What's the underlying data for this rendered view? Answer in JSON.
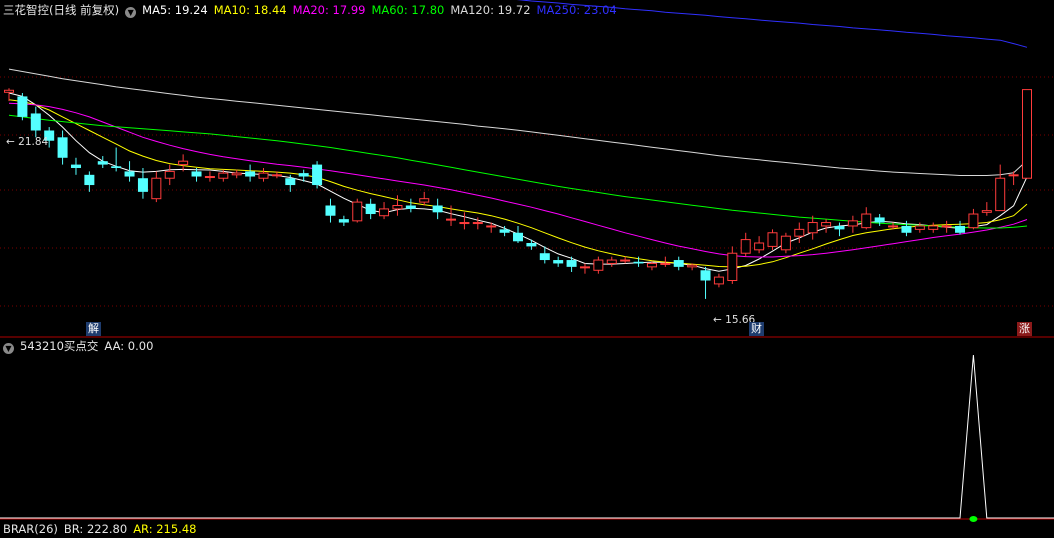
{
  "stock_title": "三花智控(日线 前复权)",
  "ma_legend": [
    {
      "label": "MA5: 19.24",
      "color": "#ffffff"
    },
    {
      "label": "MA10: 18.44",
      "color": "#ffff00"
    },
    {
      "label": "MA20: 17.99",
      "color": "#ff00ff"
    },
    {
      "label": "MA60: 17.80",
      "color": "#00ff00"
    },
    {
      "label": "MA120: 19.72",
      "color": "#d9d9d9"
    },
    {
      "label": "MA250: 23.04",
      "color": "#3030ff"
    }
  ],
  "annotations": {
    "high": "21.84",
    "low": "15.66"
  },
  "event_markers": {
    "jie": "解",
    "cai": "财",
    "zhang": "涨"
  },
  "indicator": {
    "name": "543210买点交",
    "value": "AA: 0.00"
  },
  "bottom_panel": {
    "name": "BRAR(26)",
    "br": "BR: 222.80",
    "ar": "AR: 215.48"
  },
  "colors": {
    "up": "#ff3c3c",
    "down": "#54ffff",
    "separator": "#8b0000",
    "grid": "#7a0000"
  },
  "chart_data": {
    "type": "candlestick",
    "price_ylim": [
      15.1,
      23.9
    ],
    "candles": [
      [
        21.72,
        21.78,
        21.84,
        21.46
      ],
      [
        21.6,
        21.0,
        21.7,
        20.9
      ],
      [
        21.1,
        20.6,
        21.3,
        20.4
      ],
      [
        20.6,
        20.3,
        20.7,
        20.1
      ],
      [
        20.4,
        19.8,
        20.6,
        19.6
      ],
      [
        19.6,
        19.5,
        19.8,
        19.3
      ],
      [
        19.3,
        19.0,
        19.4,
        18.8
      ],
      [
        19.7,
        19.6,
        19.85,
        19.5
      ],
      [
        19.55,
        19.5,
        20.1,
        19.4
      ],
      [
        19.4,
        19.25,
        19.7,
        19.1
      ],
      [
        19.2,
        18.8,
        19.5,
        18.6
      ],
      [
        18.6,
        19.2,
        19.4,
        18.5
      ],
      [
        19.2,
        19.4,
        19.6,
        19.0
      ],
      [
        19.6,
        19.7,
        19.9,
        19.4
      ],
      [
        19.4,
        19.25,
        19.5,
        19.1
      ],
      [
        19.25,
        19.25,
        19.4,
        19.1
      ],
      [
        19.2,
        19.35,
        19.45,
        19.1
      ],
      [
        19.3,
        19.35,
        19.45,
        19.2
      ],
      [
        19.4,
        19.25,
        19.6,
        19.1
      ],
      [
        19.2,
        19.35,
        19.5,
        19.1
      ],
      [
        19.3,
        19.3,
        19.4,
        19.2
      ],
      [
        19.2,
        19.0,
        19.3,
        18.8
      ],
      [
        19.35,
        19.25,
        19.45,
        19.1
      ],
      [
        19.6,
        19.0,
        19.7,
        18.9
      ],
      [
        18.4,
        18.1,
        18.6,
        17.9
      ],
      [
        18.0,
        17.9,
        18.1,
        17.8
      ],
      [
        17.95,
        18.5,
        18.6,
        17.9
      ],
      [
        18.45,
        18.15,
        18.6,
        18.0
      ],
      [
        18.1,
        18.3,
        18.5,
        18.0
      ],
      [
        18.3,
        18.4,
        18.7,
        18.1
      ],
      [
        18.4,
        18.3,
        18.6,
        18.2
      ],
      [
        18.5,
        18.6,
        18.8,
        18.4
      ],
      [
        18.4,
        18.2,
        18.6,
        18.0
      ],
      [
        18.0,
        18.0,
        18.4,
        17.8
      ],
      [
        17.9,
        17.9,
        18.2,
        17.7
      ],
      [
        17.9,
        17.9,
        18.05,
        17.7
      ],
      [
        17.8,
        17.8,
        17.9,
        17.6
      ],
      [
        17.7,
        17.6,
        17.8,
        17.5
      ],
      [
        17.6,
        17.35,
        17.8,
        17.3
      ],
      [
        17.3,
        17.2,
        17.4,
        17.1
      ],
      [
        17.0,
        16.8,
        17.2,
        16.7
      ],
      [
        16.8,
        16.7,
        16.9,
        16.6
      ],
      [
        16.8,
        16.6,
        16.9,
        16.45
      ],
      [
        16.6,
        16.6,
        16.7,
        16.4
      ],
      [
        16.5,
        16.8,
        16.9,
        16.4
      ],
      [
        16.7,
        16.8,
        16.9,
        16.6
      ],
      [
        16.8,
        16.8,
        16.9,
        16.7
      ],
      [
        16.75,
        16.7,
        16.9,
        16.6
      ],
      [
        16.6,
        16.7,
        16.75,
        16.5
      ],
      [
        16.7,
        16.7,
        16.9,
        16.6
      ],
      [
        16.8,
        16.6,
        16.9,
        16.5
      ],
      [
        16.6,
        16.65,
        16.7,
        16.5
      ],
      [
        16.5,
        16.2,
        16.6,
        15.66
      ],
      [
        16.1,
        16.3,
        16.4,
        16.0
      ],
      [
        16.2,
        17.0,
        17.2,
        16.1
      ],
      [
        17.0,
        17.4,
        17.6,
        16.9
      ],
      [
        17.1,
        17.3,
        17.5,
        17.0
      ],
      [
        17.2,
        17.6,
        17.7,
        17.1
      ],
      [
        17.1,
        17.5,
        17.6,
        17.0
      ],
      [
        17.5,
        17.7,
        17.9,
        17.3
      ],
      [
        17.6,
        17.9,
        18.1,
        17.4
      ],
      [
        17.8,
        17.9,
        18.0,
        17.6
      ],
      [
        17.8,
        17.7,
        17.9,
        17.5
      ],
      [
        17.8,
        17.95,
        18.1,
        17.6
      ],
      [
        17.75,
        18.15,
        18.35,
        17.7
      ],
      [
        18.05,
        17.9,
        18.15,
        17.8
      ],
      [
        17.8,
        17.8,
        17.9,
        17.7
      ],
      [
        17.8,
        17.6,
        17.95,
        17.5
      ],
      [
        17.7,
        17.8,
        17.9,
        17.6
      ],
      [
        17.7,
        17.8,
        17.9,
        17.6
      ],
      [
        17.8,
        17.8,
        17.95,
        17.6
      ],
      [
        17.8,
        17.6,
        17.95,
        17.55
      ],
      [
        17.75,
        18.15,
        18.3,
        17.7
      ],
      [
        18.2,
        18.25,
        18.5,
        18.1
      ],
      [
        18.25,
        19.2,
        19.6,
        18.25
      ],
      [
        19.3,
        19.3,
        19.4,
        19.0
      ],
      [
        19.2,
        21.8,
        21.8,
        19.2
      ]
    ],
    "ma_series": [
      {
        "name": "MA5",
        "color": "#ffffff",
        "values": [
          21.7,
          21.6,
          21.35,
          21.05,
          20.7,
          20.3,
          19.95,
          19.7,
          19.55,
          19.42,
          19.38,
          19.4,
          19.45,
          19.46,
          19.45,
          19.44,
          19.4,
          19.35,
          19.33,
          19.31,
          19.28,
          19.22,
          19.13,
          19.03,
          18.82,
          18.61,
          18.43,
          18.26,
          18.19,
          18.28,
          18.32,
          18.3,
          18.26,
          18.16,
          18.07,
          17.97,
          17.88,
          17.73,
          17.56,
          17.38,
          17.17,
          16.98,
          16.85,
          16.7,
          16.68,
          16.68,
          16.7,
          16.72,
          16.74,
          16.73,
          16.7,
          16.65,
          16.55,
          16.47,
          16.54,
          16.64,
          16.83,
          17.06,
          17.3,
          17.45,
          17.62,
          17.74,
          17.8,
          17.83,
          17.89,
          17.94,
          17.91,
          17.86,
          17.84,
          17.8,
          17.76,
          17.73,
          17.78,
          17.84,
          18.1,
          18.39,
          19.24
        ]
      },
      {
        "name": "MA10",
        "color": "#ffff00",
        "values": [
          21.5,
          21.45,
          21.35,
          21.2,
          21.0,
          20.8,
          20.6,
          20.4,
          20.2,
          20.0,
          19.85,
          19.72,
          19.63,
          19.57,
          19.52,
          19.48,
          19.46,
          19.44,
          19.42,
          19.4,
          19.38,
          19.35,
          19.3,
          19.22,
          19.1,
          18.96,
          18.85,
          18.75,
          18.66,
          18.57,
          18.48,
          18.42,
          18.37,
          18.3,
          18.24,
          18.18,
          18.1,
          18.0,
          17.88,
          17.75,
          17.6,
          17.45,
          17.31,
          17.18,
          17.07,
          16.98,
          16.9,
          16.84,
          16.78,
          16.74,
          16.71,
          16.68,
          16.65,
          16.61,
          16.6,
          16.62,
          16.67,
          16.75,
          16.87,
          17.0,
          17.13,
          17.27,
          17.4,
          17.52,
          17.6,
          17.66,
          17.72,
          17.76,
          17.8,
          17.82,
          17.84,
          17.85,
          17.87,
          17.9,
          17.98,
          18.1,
          18.44
        ]
      },
      {
        "name": "MA20",
        "color": "#ff00ff",
        "values": [
          21.4,
          21.38,
          21.35,
          21.3,
          21.22,
          21.12,
          21.0,
          20.85,
          20.7,
          20.55,
          20.4,
          20.28,
          20.17,
          20.07,
          19.98,
          19.9,
          19.83,
          19.77,
          19.71,
          19.66,
          19.61,
          19.57,
          19.52,
          19.47,
          19.42,
          19.36,
          19.3,
          19.24,
          19.18,
          19.12,
          19.06,
          19.0,
          18.93,
          18.86,
          18.78,
          18.7,
          18.62,
          18.53,
          18.44,
          18.35,
          18.25,
          18.15,
          18.04,
          17.93,
          17.82,
          17.71,
          17.6,
          17.5,
          17.4,
          17.3,
          17.21,
          17.13,
          17.05,
          16.98,
          16.93,
          16.9,
          16.89,
          16.89,
          16.91,
          16.93,
          16.96,
          17.0,
          17.05,
          17.1,
          17.16,
          17.22,
          17.28,
          17.34,
          17.4,
          17.46,
          17.51,
          17.56,
          17.62,
          17.68,
          17.76,
          17.85,
          17.99
        ]
      },
      {
        "name": "MA60",
        "color": "#00ff00",
        "values": [
          21.05,
          21.0,
          20.95,
          20.9,
          20.86,
          20.82,
          20.78,
          20.74,
          20.71,
          20.68,
          20.65,
          20.62,
          20.59,
          20.56,
          20.53,
          20.5,
          20.46,
          20.42,
          20.38,
          20.34,
          20.3,
          20.25,
          20.2,
          20.15,
          20.1,
          20.04,
          19.98,
          19.92,
          19.86,
          19.8,
          19.73,
          19.66,
          19.59,
          19.52,
          19.45,
          19.38,
          19.31,
          19.24,
          19.17,
          19.1,
          19.03,
          18.96,
          18.9,
          18.84,
          18.78,
          18.72,
          18.66,
          18.61,
          18.56,
          18.51,
          18.46,
          18.41,
          18.36,
          18.31,
          18.26,
          18.22,
          18.18,
          18.14,
          18.1,
          18.06,
          18.03,
          18.0,
          17.97,
          17.94,
          17.91,
          17.88,
          17.86,
          17.84,
          17.82,
          17.8,
          17.78,
          17.76,
          17.75,
          17.74,
          17.74,
          17.76,
          17.8
        ]
      },
      {
        "name": "MA120",
        "color": "#d9d9d9",
        "values": [
          22.4,
          22.33,
          22.26,
          22.19,
          22.12,
          22.06,
          22.0,
          21.94,
          21.88,
          21.83,
          21.78,
          21.73,
          21.68,
          21.63,
          21.58,
          21.54,
          21.5,
          21.46,
          21.42,
          21.38,
          21.34,
          21.3,
          21.26,
          21.22,
          21.18,
          21.14,
          21.1,
          21.06,
          21.02,
          20.98,
          20.94,
          20.9,
          20.86,
          20.82,
          20.78,
          20.73,
          20.69,
          20.65,
          20.61,
          20.56,
          20.51,
          20.46,
          20.41,
          20.36,
          20.31,
          20.26,
          20.21,
          20.16,
          20.11,
          20.06,
          20.01,
          19.96,
          19.91,
          19.86,
          19.82,
          19.78,
          19.74,
          19.7,
          19.66,
          19.62,
          19.58,
          19.54,
          19.5,
          19.47,
          19.44,
          19.41,
          19.38,
          19.36,
          19.34,
          19.32,
          19.3,
          19.28,
          19.28,
          19.28,
          19.3,
          19.36,
          19.72
        ]
      },
      {
        "name": "MA250",
        "color": "#3030ff",
        "values": [
          25.65,
          25.62,
          25.59,
          25.56,
          25.53,
          25.5,
          25.47,
          25.44,
          25.41,
          25.37,
          25.34,
          25.31,
          25.28,
          25.25,
          25.22,
          25.19,
          25.15,
          25.12,
          25.09,
          25.06,
          25.02,
          24.99,
          24.96,
          24.93,
          24.89,
          24.86,
          24.83,
          24.8,
          24.76,
          24.73,
          24.7,
          24.66,
          24.63,
          24.6,
          24.57,
          24.53,
          24.5,
          24.47,
          24.44,
          24.4,
          24.37,
          24.34,
          24.3,
          24.27,
          24.24,
          24.21,
          24.17,
          24.14,
          24.11,
          24.07,
          24.04,
          24.01,
          23.98,
          23.94,
          23.91,
          23.88,
          23.84,
          23.81,
          23.78,
          23.75,
          23.71,
          23.68,
          23.65,
          23.61,
          23.58,
          23.55,
          23.52,
          23.48,
          23.45,
          23.42,
          23.38,
          23.35,
          23.32,
          23.28,
          23.25,
          23.15,
          23.04
        ]
      }
    ],
    "indicator_spike": {
      "ylim": [
        0,
        1
      ],
      "peak_index": 72,
      "peak_value": 1.0
    }
  }
}
